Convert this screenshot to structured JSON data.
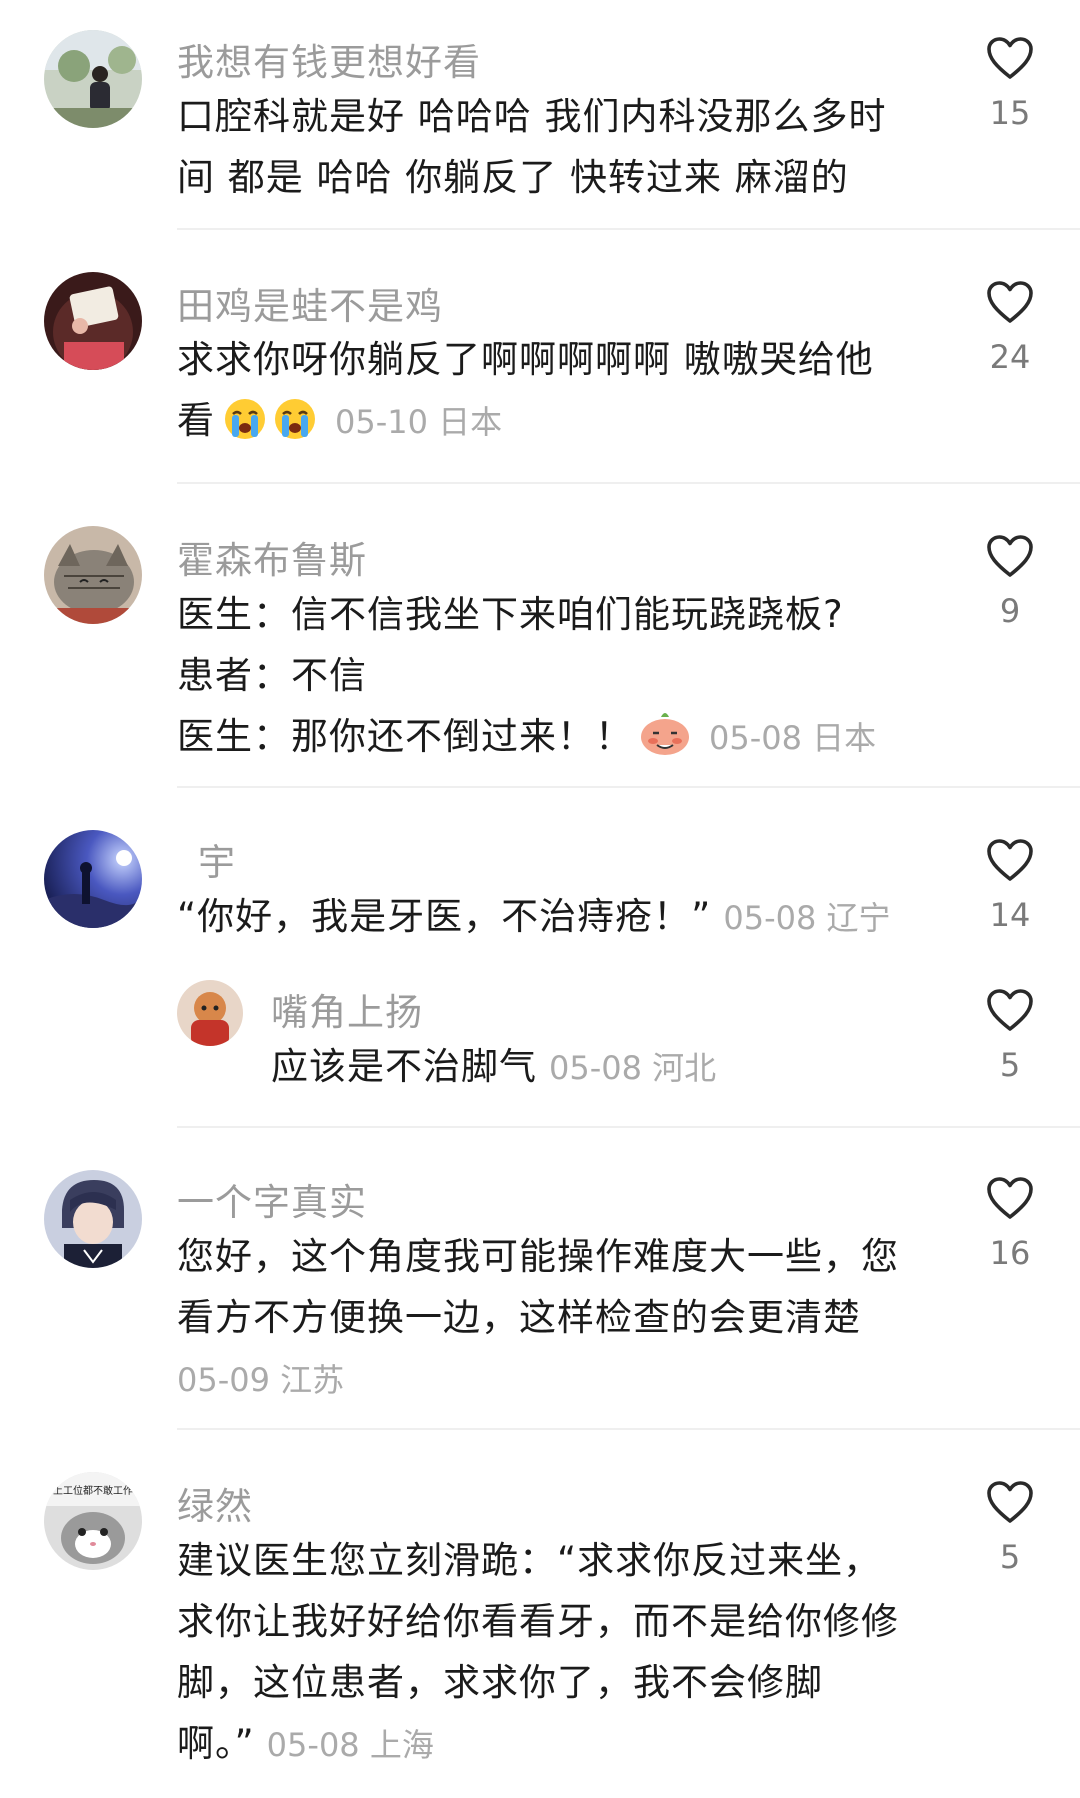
{
  "comments": [
    {
      "username": "我想有钱更想好看",
      "lines": [
        "口腔科就是好 哈哈哈 我们内科没那么多时",
        "间 都是 哈哈 你躺反了 快转过来 麻溜的"
      ],
      "likes": "15"
    },
    {
      "username": "田鸡是蛙不是鸡",
      "lines": [
        "求求你呀你躺反了啊啊啊啊啊 嗷嗷哭给他",
        "看"
      ],
      "meta": "05-10 日本",
      "emoji": [
        "crying-emoji",
        "crying-emoji"
      ],
      "likes": "24"
    },
    {
      "username": "霍森布鲁斯",
      "lines": [
        "医生：信不信我坐下来咱们能玩跷跷板?",
        "患者：不信",
        "医生：那你还不倒过来！！"
      ],
      "meta": "05-08 日本",
      "emoji": [
        "embarrassed-emoji"
      ],
      "likes": "9"
    },
    {
      "username": "宇",
      "lines": [
        "“你好，我是牙医，不治痔疮！”"
      ],
      "meta": "05-08 辽宁",
      "likes": "14",
      "reply": {
        "username": "嘴角上扬",
        "lines": [
          "应该是不治脚气"
        ],
        "meta": "05-08 河北",
        "likes": "5"
      }
    },
    {
      "username": "一个字真实",
      "lines": [
        "您好，这个角度我可能操作难度大一些，您",
        "看方不方便换一边，这样检查的会更清楚"
      ],
      "meta": "05-09 江苏",
      "likes": "16"
    },
    {
      "username": "绿然",
      "lines": [
        "建议医生您立刻滑跪：“求求你反过来坐，",
        "求你让我好好给你看看牙，而不是给你修修",
        "脚，这位患者，求求你了，我不会修脚",
        "啊。”"
      ],
      "meta": "05-08 上海",
      "likes": "5",
      "avatar_caption": "上工位都不敢工作"
    }
  ],
  "colors": {
    "username": "#9b9b9b",
    "text": "#1b1b1b",
    "meta": "#aaaaaa",
    "like_count": "#7a7a7a",
    "heart_outline": "#2a2a2a",
    "divider": "#efefef"
  }
}
